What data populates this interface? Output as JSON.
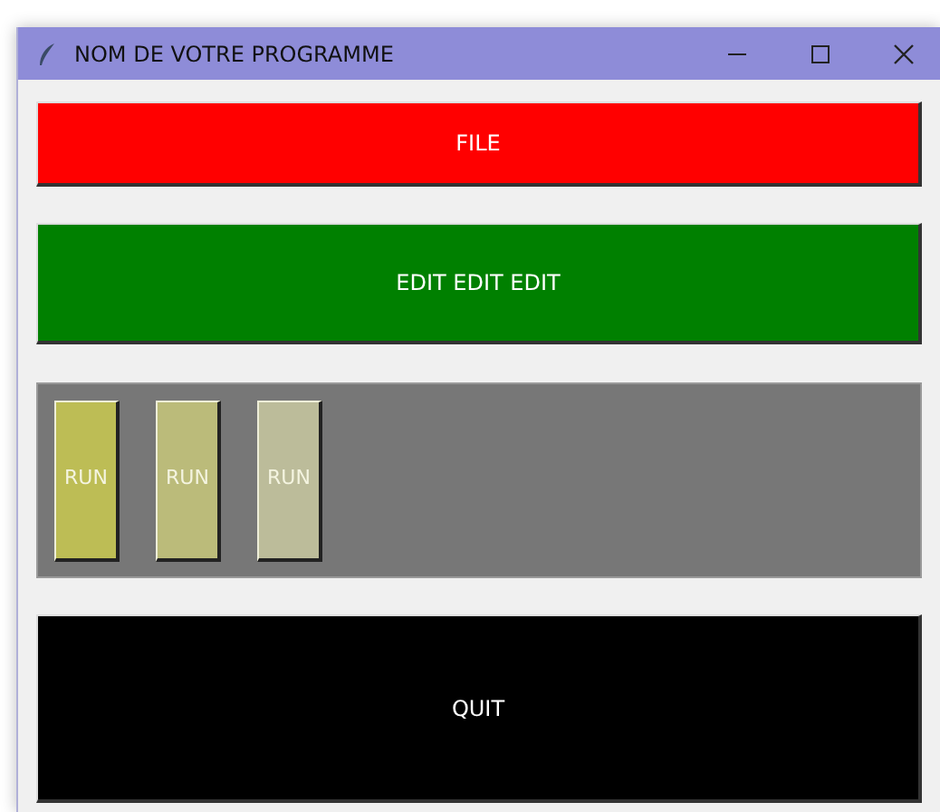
{
  "window": {
    "title": "NOM DE VOTRE PROGRAMME"
  },
  "file_button": {
    "label": "FILE",
    "color": "#ff0000"
  },
  "edit_button": {
    "label": "EDIT EDIT EDIT",
    "color": "#008000"
  },
  "run_buttons": [
    {
      "label": "RUN",
      "color": "#bdbd55"
    },
    {
      "label": "RUN",
      "color": "#bbbb7a"
    },
    {
      "label": "RUN",
      "color": "#bcbc9a"
    }
  ],
  "quit_button": {
    "label": "QUIT",
    "color": "#000000"
  }
}
